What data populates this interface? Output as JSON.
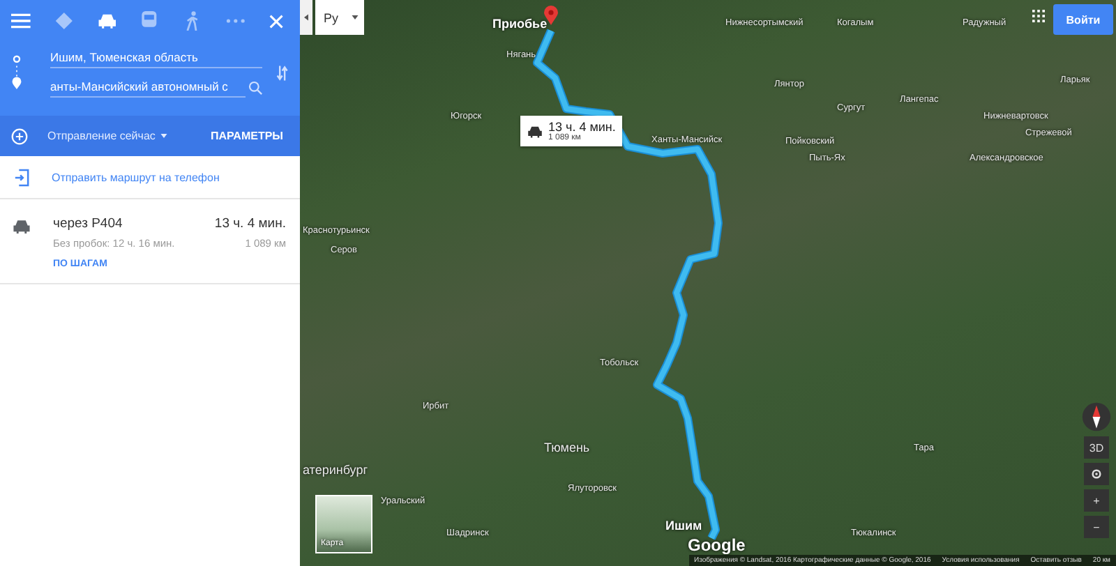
{
  "travel_modes": [
    {
      "kind": "best",
      "selected": false
    },
    {
      "kind": "car",
      "selected": true
    },
    {
      "kind": "transit",
      "selected": false
    },
    {
      "kind": "walk",
      "selected": false
    },
    {
      "kind": "more",
      "selected": false
    }
  ],
  "origin": {
    "value": "Ишим, Тюменская область"
  },
  "destination": {
    "value": "анты-Мансийский автономный с"
  },
  "departure": {
    "label": "Отправление сейчас",
    "options_button": "ПАРАМЕТРЫ"
  },
  "send_to_phone": "Отправить маршрут на телефон",
  "routes": [
    {
      "via": "через Р404",
      "time": "13 ч. 4 мин.",
      "no_traffic": "Без пробок: 12 ч. 16 мин.",
      "distance": "1 089 км",
      "steps_link": "ПО ШАГАМ"
    }
  ],
  "language": "Ру",
  "sign_in": "Войти",
  "route_callout": {
    "time": "13 ч. 4 мин.",
    "distance": "1 089 км"
  },
  "places": [
    {
      "name": "Приобье",
      "kind": "endpoint"
    },
    {
      "name": "Нижнесортымский",
      "kind": "town"
    },
    {
      "name": "Когалым",
      "kind": "town"
    },
    {
      "name": "Радужный",
      "kind": "town"
    },
    {
      "name": "Нягань",
      "kind": "town"
    },
    {
      "name": "Ларьяк",
      "kind": "town"
    },
    {
      "name": "Лянтор",
      "kind": "town"
    },
    {
      "name": "Лангепас",
      "kind": "town"
    },
    {
      "name": "Сургут",
      "kind": "town"
    },
    {
      "name": "Югорск",
      "kind": "town"
    },
    {
      "name": "Нижневартовск",
      "kind": "town"
    },
    {
      "name": "Стрежевой",
      "kind": "town"
    },
    {
      "name": "Ханты-Мансийск",
      "kind": "town"
    },
    {
      "name": "Пойковский",
      "kind": "town"
    },
    {
      "name": "Пыть-Ях",
      "kind": "town"
    },
    {
      "name": "Александровское",
      "kind": "town"
    },
    {
      "name": "Краснотурьинск",
      "kind": "town"
    },
    {
      "name": "Серов",
      "kind": "town"
    },
    {
      "name": "Тобольск",
      "kind": "town"
    },
    {
      "name": "Ирбит",
      "kind": "town"
    },
    {
      "name": "Тюмень",
      "kind": "city"
    },
    {
      "name": "Тара",
      "kind": "town"
    },
    {
      "name": "атеринбург",
      "kind": "city"
    },
    {
      "name": "Ялуторовск",
      "kind": "town"
    },
    {
      "name": "Уральский",
      "kind": "town"
    },
    {
      "name": "Ишим",
      "kind": "endpoint"
    },
    {
      "name": "Шадринск",
      "kind": "town"
    },
    {
      "name": "Тюкалинск",
      "kind": "town"
    }
  ],
  "map_type_thumb": "Карта",
  "map_logo": "Google",
  "footer": [
    "Изображения © Landsat, 2016 Картографические данные © Google, 2016",
    "Условия использования",
    "Оставить отзыв",
    "20 км"
  ],
  "map_controls": [
    "3D",
    "+",
    "−"
  ]
}
